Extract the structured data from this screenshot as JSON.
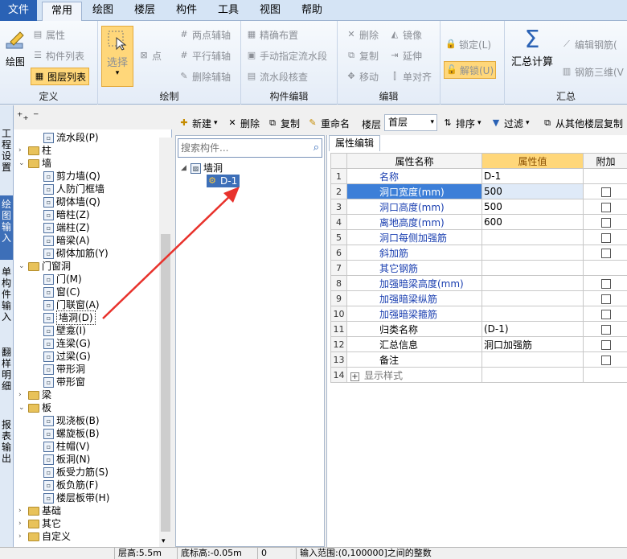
{
  "menu_tabs": [
    "文件",
    "常用",
    "绘图",
    "楼层",
    "构件",
    "工具",
    "视图",
    "帮助"
  ],
  "ribbon": {
    "define": {
      "label": "定义",
      "draw": "绘图",
      "props": "属性",
      "comp_list": "构件列表",
      "layer_list": "图层列表"
    },
    "draw": {
      "label": "绘制",
      "select": "选择",
      "point": "点",
      "two_point_axis": "两点辅轴",
      "parallel_axis": "平行辅轴",
      "delete_axis": "删除辅轴"
    },
    "comp_edit": {
      "label": "构件编辑",
      "precise": "精确布置",
      "manual_flow": "手动指定流水段",
      "flow_check": "流水段核查"
    },
    "edit": {
      "label": "编辑",
      "delete": "删除",
      "mirror": "镜像",
      "copy": "复制",
      "extend": "延伸",
      "move": "移动",
      "single_align": "单对齐"
    },
    "lock": {
      "lock": "锁定(L)",
      "unlock": "解锁(U)"
    },
    "summary": {
      "label": "汇总",
      "calc": "汇总计算",
      "edit_rebar": "编辑钢筋(",
      "rebar_3d": "钢筋三维(V"
    }
  },
  "left_nav": [
    "工程设置",
    "绘图输入",
    "单构件输入",
    "报表输出"
  ],
  "left_nav2": "翻样明细",
  "tree": [
    {
      "label": "流水段(P)",
      "level": 2
    },
    {
      "label": "柱",
      "level": 1,
      "folder": true,
      "expanded": false
    },
    {
      "label": "墙",
      "level": 1,
      "folder": true,
      "expanded": true
    },
    {
      "label": "剪力墙(Q)",
      "level": 2
    },
    {
      "label": "人防门框墙",
      "level": 2
    },
    {
      "label": "砌体墙(Q)",
      "level": 2
    },
    {
      "label": "暗柱(Z)",
      "level": 2
    },
    {
      "label": "端柱(Z)",
      "level": 2
    },
    {
      "label": "暗梁(A)",
      "level": 2
    },
    {
      "label": "砌体加筋(Y)",
      "level": 2
    },
    {
      "label": "门窗洞",
      "level": 1,
      "folder": true,
      "expanded": true
    },
    {
      "label": "门(M)",
      "level": 2
    },
    {
      "label": "窗(C)",
      "level": 2
    },
    {
      "label": "门联窗(A)",
      "level": 2
    },
    {
      "label": "墙洞(D)",
      "level": 2,
      "selected": true
    },
    {
      "label": "壁龛(I)",
      "level": 2
    },
    {
      "label": "连梁(G)",
      "level": 2
    },
    {
      "label": "过梁(G)",
      "level": 2
    },
    {
      "label": "带形洞",
      "level": 2
    },
    {
      "label": "带形窗",
      "level": 2
    },
    {
      "label": "梁",
      "level": 1,
      "folder": true,
      "expanded": false
    },
    {
      "label": "板",
      "level": 1,
      "folder": true,
      "expanded": true
    },
    {
      "label": "现浇板(B)",
      "level": 2
    },
    {
      "label": "螺旋板(B)",
      "level": 2
    },
    {
      "label": "柱帽(V)",
      "level": 2
    },
    {
      "label": "板洞(N)",
      "level": 2
    },
    {
      "label": "板受力筋(S)",
      "level": 2
    },
    {
      "label": "板负筋(F)",
      "level": 2
    },
    {
      "label": "楼层板带(H)",
      "level": 2
    },
    {
      "label": "基础",
      "level": 1,
      "folder": true,
      "expanded": false
    },
    {
      "label": "其它",
      "level": 1,
      "folder": true,
      "expanded": false
    },
    {
      "label": "自定义",
      "level": 1,
      "folder": true,
      "expanded": false
    }
  ],
  "toolbar": {
    "new": "新建",
    "delete": "删除",
    "copy": "复制",
    "rename": "重命名",
    "floor_label": "楼层",
    "floor_value": "首层",
    "sort": "排序",
    "filter": "过滤",
    "copy_from_floor": "从其他楼层复制"
  },
  "search": {
    "placeholder": "搜索构件..."
  },
  "comp_tree": {
    "root": "墙洞",
    "child": "D-1"
  },
  "props": {
    "tab": "属性编辑",
    "headers": [
      "属性名称",
      "属性值",
      "附加"
    ],
    "rows": [
      {
        "n": "1",
        "name": "名称",
        "value": "D-1",
        "check": false,
        "has_check": false
      },
      {
        "n": "2",
        "name": "洞口宽度(mm)",
        "value": "500",
        "check": false,
        "has_check": true,
        "selected": true
      },
      {
        "n": "3",
        "name": "洞口高度(mm)",
        "value": "500",
        "check": false,
        "has_check": true
      },
      {
        "n": "4",
        "name": "离地高度(mm)",
        "value": "600",
        "check": false,
        "has_check": true
      },
      {
        "n": "5",
        "name": "洞口每侧加强筋",
        "value": "",
        "check": false,
        "has_check": true
      },
      {
        "n": "6",
        "name": "斜加筋",
        "value": "",
        "check": false,
        "has_check": true
      },
      {
        "n": "7",
        "name": "其它钢筋",
        "value": "",
        "check": false,
        "has_check": false
      },
      {
        "n": "8",
        "name": "加强暗梁高度(mm)",
        "value": "",
        "check": false,
        "has_check": true
      },
      {
        "n": "9",
        "name": "加强暗梁纵筋",
        "value": "",
        "check": false,
        "has_check": true
      },
      {
        "n": "10",
        "name": "加强暗梁箍筋",
        "value": "",
        "check": false,
        "has_check": true
      },
      {
        "n": "11",
        "name": "归类名称",
        "value": "(D-1)",
        "check": false,
        "has_check": true,
        "black": true
      },
      {
        "n": "12",
        "name": "汇总信息",
        "value": "洞口加强筋",
        "check": false,
        "has_check": true,
        "black": true
      },
      {
        "n": "13",
        "name": "备注",
        "value": "",
        "check": false,
        "has_check": true,
        "black": true
      },
      {
        "n": "14",
        "name": "显示样式",
        "value": "",
        "check": false,
        "has_check": false,
        "gray": true,
        "expander": true
      }
    ]
  },
  "status": {
    "floor_height": "层高:5.5m",
    "bottom_elev": "底标高:-0.05m",
    "zero": "0",
    "hint": "输入范围:(0,100000]之间的整数"
  },
  "colors": {
    "accent": "#2a62b5",
    "highlight": "#ffd77a",
    "selected_row": "#3d7fd8",
    "arrow": "#e8322c"
  }
}
